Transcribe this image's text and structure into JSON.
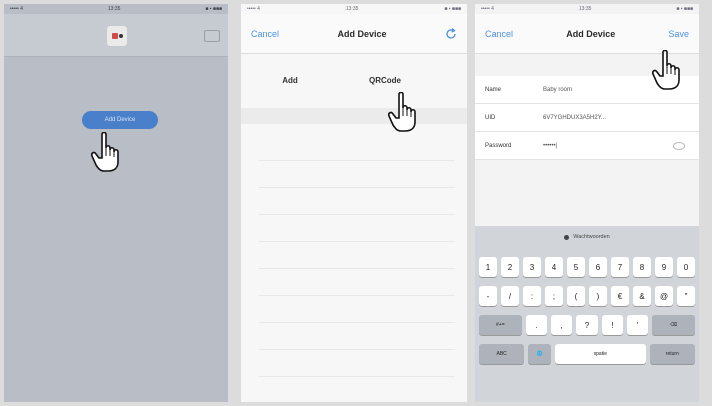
{
  "screen1": {
    "status": {
      "left": "••••• 4",
      "center": "13:35",
      "right": "■ ▪ ■■■"
    },
    "button_label": "Add Device"
  },
  "screen2": {
    "status": {
      "left": "••••• 4",
      "center": "13:35",
      "right": "■ ▪ ■■■"
    },
    "nav": {
      "cancel": "Cancel",
      "title": "Add Device"
    },
    "options": [
      "Add",
      "QRCode"
    ]
  },
  "screen3": {
    "status": {
      "left": "••••• 4",
      "center": "13:35",
      "right": "■ ▪ ■■■"
    },
    "nav": {
      "cancel": "Cancel",
      "title": "Add Device",
      "save": "Save"
    },
    "fields": [
      {
        "label": "Name",
        "value": "Baby room"
      },
      {
        "label": "UID",
        "value": "6V7YGHDUX3A5H2Y..."
      },
      {
        "label": "Password",
        "value": "••••••|"
      }
    ],
    "keyboard": {
      "suggestion": "Wachtwoorden",
      "row1": [
        "1",
        "2",
        "3",
        "4",
        "5",
        "6",
        "7",
        "8",
        "9",
        "0"
      ],
      "row2": [
        "-",
        "/",
        ":",
        ";",
        "(",
        ")",
        "€",
        "&",
        "@",
        "\""
      ],
      "row3": [
        "#+=",
        ".",
        ",",
        "?",
        "!",
        "'",
        "⌫"
      ],
      "row4": [
        "ABC",
        "🌐",
        "spatie",
        "return"
      ]
    }
  }
}
